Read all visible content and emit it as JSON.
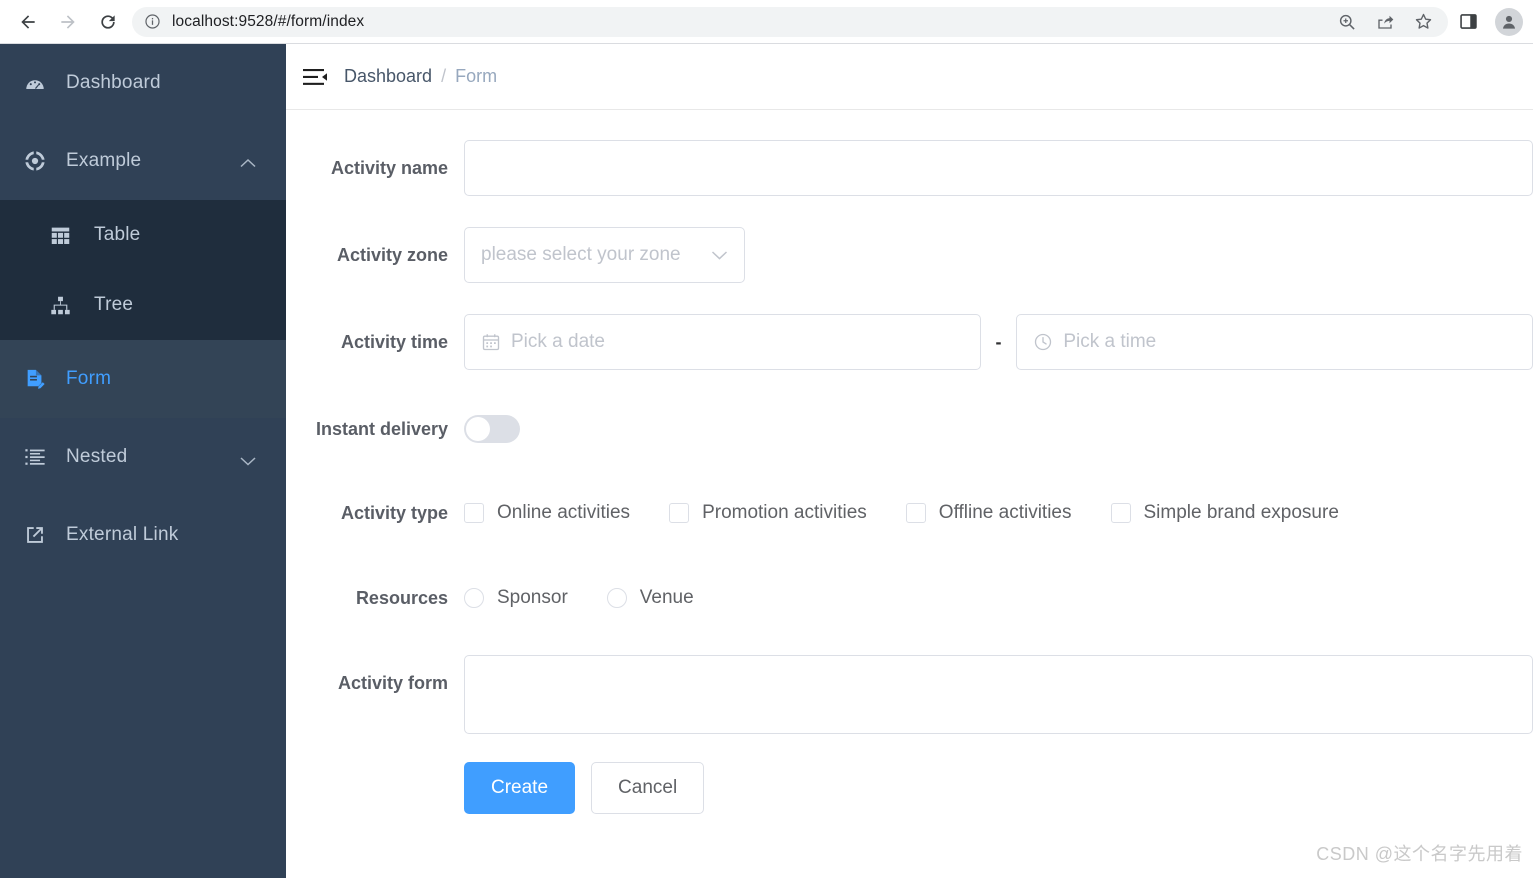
{
  "browser": {
    "url": "localhost:9528/#/form/index",
    "back_icon": "back-arrow-icon",
    "forward_icon": "forward-arrow-icon",
    "reload_icon": "reload-icon",
    "info_icon": "site-info-icon",
    "zoom_icon": "zoom-in-icon",
    "share_icon": "share-icon",
    "bookmark_icon": "star-icon",
    "panel_icon": "side-panel-icon",
    "profile_icon": "profile-avatar-icon"
  },
  "sidebar": {
    "background": "#304156",
    "submenu_background": "#1f2d3d",
    "active_color": "#409eff",
    "items": [
      {
        "label": "Dashboard",
        "icon": "dashboard-icon",
        "active": false
      },
      {
        "label": "Example",
        "icon": "component-icon",
        "active": false,
        "arrow": "chevron-up-icon"
      },
      {
        "label": "Table",
        "icon": "table-icon",
        "active": false
      },
      {
        "label": "Tree",
        "icon": "tree-icon",
        "active": false
      },
      {
        "label": "Form",
        "icon": "form-document-icon",
        "active": true
      },
      {
        "label": "Nested",
        "icon": "nested-list-icon",
        "active": false,
        "arrow": "chevron-down-icon"
      },
      {
        "label": "External Link",
        "icon": "external-link-icon",
        "active": false
      }
    ]
  },
  "navbar": {
    "hamburger_icon": "collapse-menu-icon",
    "breadcrumb": {
      "parent": "Dashboard",
      "separator": "/",
      "current": "Form"
    }
  },
  "form": {
    "activity_name": {
      "label": "Activity name",
      "value": "",
      "placeholder": ""
    },
    "activity_zone": {
      "label": "Activity zone",
      "value": "",
      "placeholder": "please select your zone",
      "arrow_icon": "chevron-down-icon"
    },
    "activity_time": {
      "label": "Activity time",
      "date": {
        "value": "",
        "placeholder": "Pick a date",
        "icon": "calendar-icon"
      },
      "separator": "-",
      "time": {
        "value": "",
        "placeholder": "Pick a time",
        "icon": "clock-icon"
      }
    },
    "instant_delivery": {
      "label": "Instant delivery",
      "checked": false
    },
    "activity_type": {
      "label": "Activity type",
      "options": [
        {
          "label": "Online activities",
          "checked": false
        },
        {
          "label": "Promotion activities",
          "checked": false
        },
        {
          "label": "Offline activities",
          "checked": false
        },
        {
          "label": "Simple brand exposure",
          "checked": false
        }
      ]
    },
    "resources": {
      "label": "Resources",
      "options": [
        {
          "label": "Sponsor",
          "selected": false
        },
        {
          "label": "Venue",
          "selected": false
        }
      ]
    },
    "activity_form": {
      "label": "Activity form",
      "value": "",
      "placeholder": ""
    },
    "buttons": {
      "submit": "Create",
      "cancel": "Cancel"
    }
  },
  "watermark": "CSDN @这个名字先用着"
}
